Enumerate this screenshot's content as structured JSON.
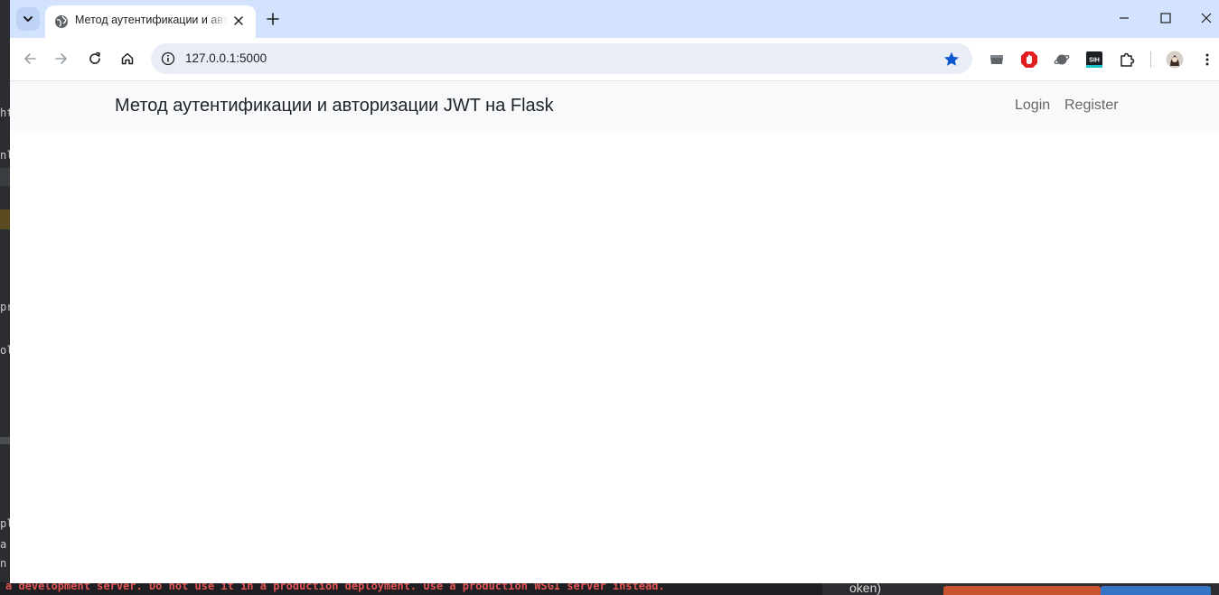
{
  "background": {
    "side_fragments": [
      "ht",
      "nl",
      "pr",
      "ol",
      "pl",
      "a",
      "n"
    ],
    "console_text": "a development server. Do not use it in a production deployment. Use a production WSGI server instead.",
    "token_fragment": "oken)"
  },
  "browser": {
    "tab": {
      "title": "Метод аутентификации и авторизации JWT на Flask"
    },
    "address_bar": {
      "url": "127.0.0.1:5000"
    },
    "extensions": [
      "storage-extension-icon",
      "adblock-extension-icon",
      "planet-extension-icon",
      "sih-extension-icon",
      "puzzle-extensions-icon"
    ],
    "sih_label": "SIH"
  },
  "page": {
    "navbar": {
      "brand": "Метод аутентификации и авторизации JWT на Flask",
      "links": [
        {
          "label": "Login"
        },
        {
          "label": "Register"
        }
      ]
    }
  },
  "colors": {
    "tabstrip": "#d3e3fd",
    "omnibox": "#e9eef6",
    "navbar_bg": "#f8f9fa",
    "star": "#0b57d0"
  }
}
